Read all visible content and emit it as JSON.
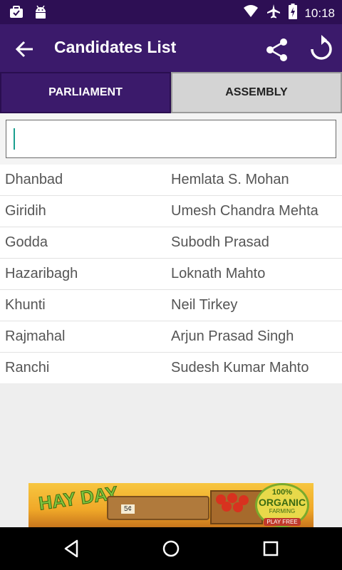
{
  "status_bar": {
    "time": "10:18",
    "icons": [
      "briefcase-icon",
      "android-icon",
      "wifi-icon",
      "airplane-icon",
      "battery-charging-icon"
    ]
  },
  "app_bar": {
    "title": "Candidates List",
    "icons": [
      "back-arrow-icon",
      "share-icon",
      "refresh-icon"
    ],
    "color": "#3b1a6b"
  },
  "tabs": [
    {
      "label": "PARLIAMENT",
      "selected": true
    },
    {
      "label": "ASSEMBLY",
      "selected": false
    }
  ],
  "search": {
    "value": "",
    "placeholder": ""
  },
  "candidates": [
    {
      "constituency": "Dhanbad",
      "candidate": "Hemlata S. Mohan"
    },
    {
      "constituency": "Giridih",
      "candidate": "Umesh Chandra Mehta"
    },
    {
      "constituency": "Godda",
      "candidate": "Subodh Prasad"
    },
    {
      "constituency": "Hazaribagh",
      "candidate": "Loknath Mahto"
    },
    {
      "constituency": "Khunti",
      "candidate": "Neil Tirkey"
    },
    {
      "constituency": "Rajmahal",
      "candidate": "Arjun Prasad Singh"
    },
    {
      "constituency": "Ranchi",
      "candidate": "Sudesh Kumar Mahto"
    }
  ],
  "ad_banner": {
    "title": "HAY DAY",
    "sign_text": "5¢",
    "badge_top": "100%",
    "badge_main": "ORGANIC",
    "badge_sub": "FARMING",
    "badge_button": "PLAY FREE"
  },
  "nav_bar": {
    "icons": [
      "back-triangle-icon",
      "home-circle-icon",
      "recents-square-icon"
    ]
  }
}
